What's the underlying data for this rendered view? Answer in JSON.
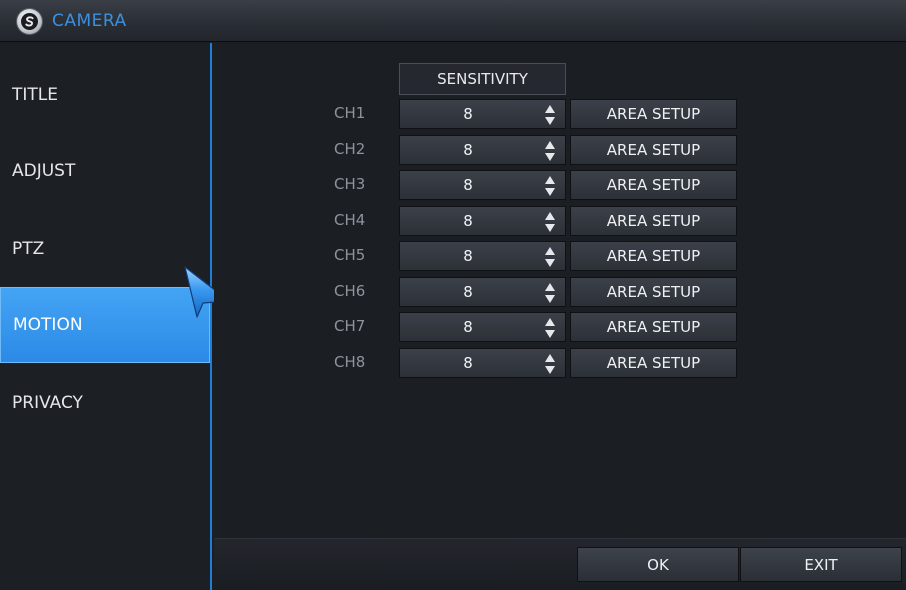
{
  "window": {
    "title": "CAMERA",
    "logo_icon": "s-logo-icon"
  },
  "sidebar": {
    "items": [
      {
        "label": "TITLE"
      },
      {
        "label": "ADJUST"
      },
      {
        "label": "PTZ"
      },
      {
        "label": "MOTION"
      },
      {
        "label": "PRIVACY"
      }
    ],
    "active_index": 3,
    "active_color": "#2b8ae6"
  },
  "table": {
    "header": "SENSITIVITY",
    "rows": [
      {
        "channel": "CH1",
        "sensitivity": "8",
        "button": "AREA SETUP"
      },
      {
        "channel": "CH2",
        "sensitivity": "8",
        "button": "AREA SETUP"
      },
      {
        "channel": "CH3",
        "sensitivity": "8",
        "button": "AREA SETUP"
      },
      {
        "channel": "CH4",
        "sensitivity": "8",
        "button": "AREA SETUP"
      },
      {
        "channel": "CH5",
        "sensitivity": "8",
        "button": "AREA SETUP"
      },
      {
        "channel": "CH6",
        "sensitivity": "8",
        "button": "AREA SETUP"
      },
      {
        "channel": "CH7",
        "sensitivity": "8",
        "button": "AREA SETUP"
      },
      {
        "channel": "CH8",
        "sensitivity": "8",
        "button": "AREA SETUP"
      }
    ]
  },
  "footer": {
    "ok_label": "OK",
    "exit_label": "EXIT"
  },
  "colors": {
    "accent": "#1f7fd8",
    "title_text": "#3d8fe0"
  }
}
